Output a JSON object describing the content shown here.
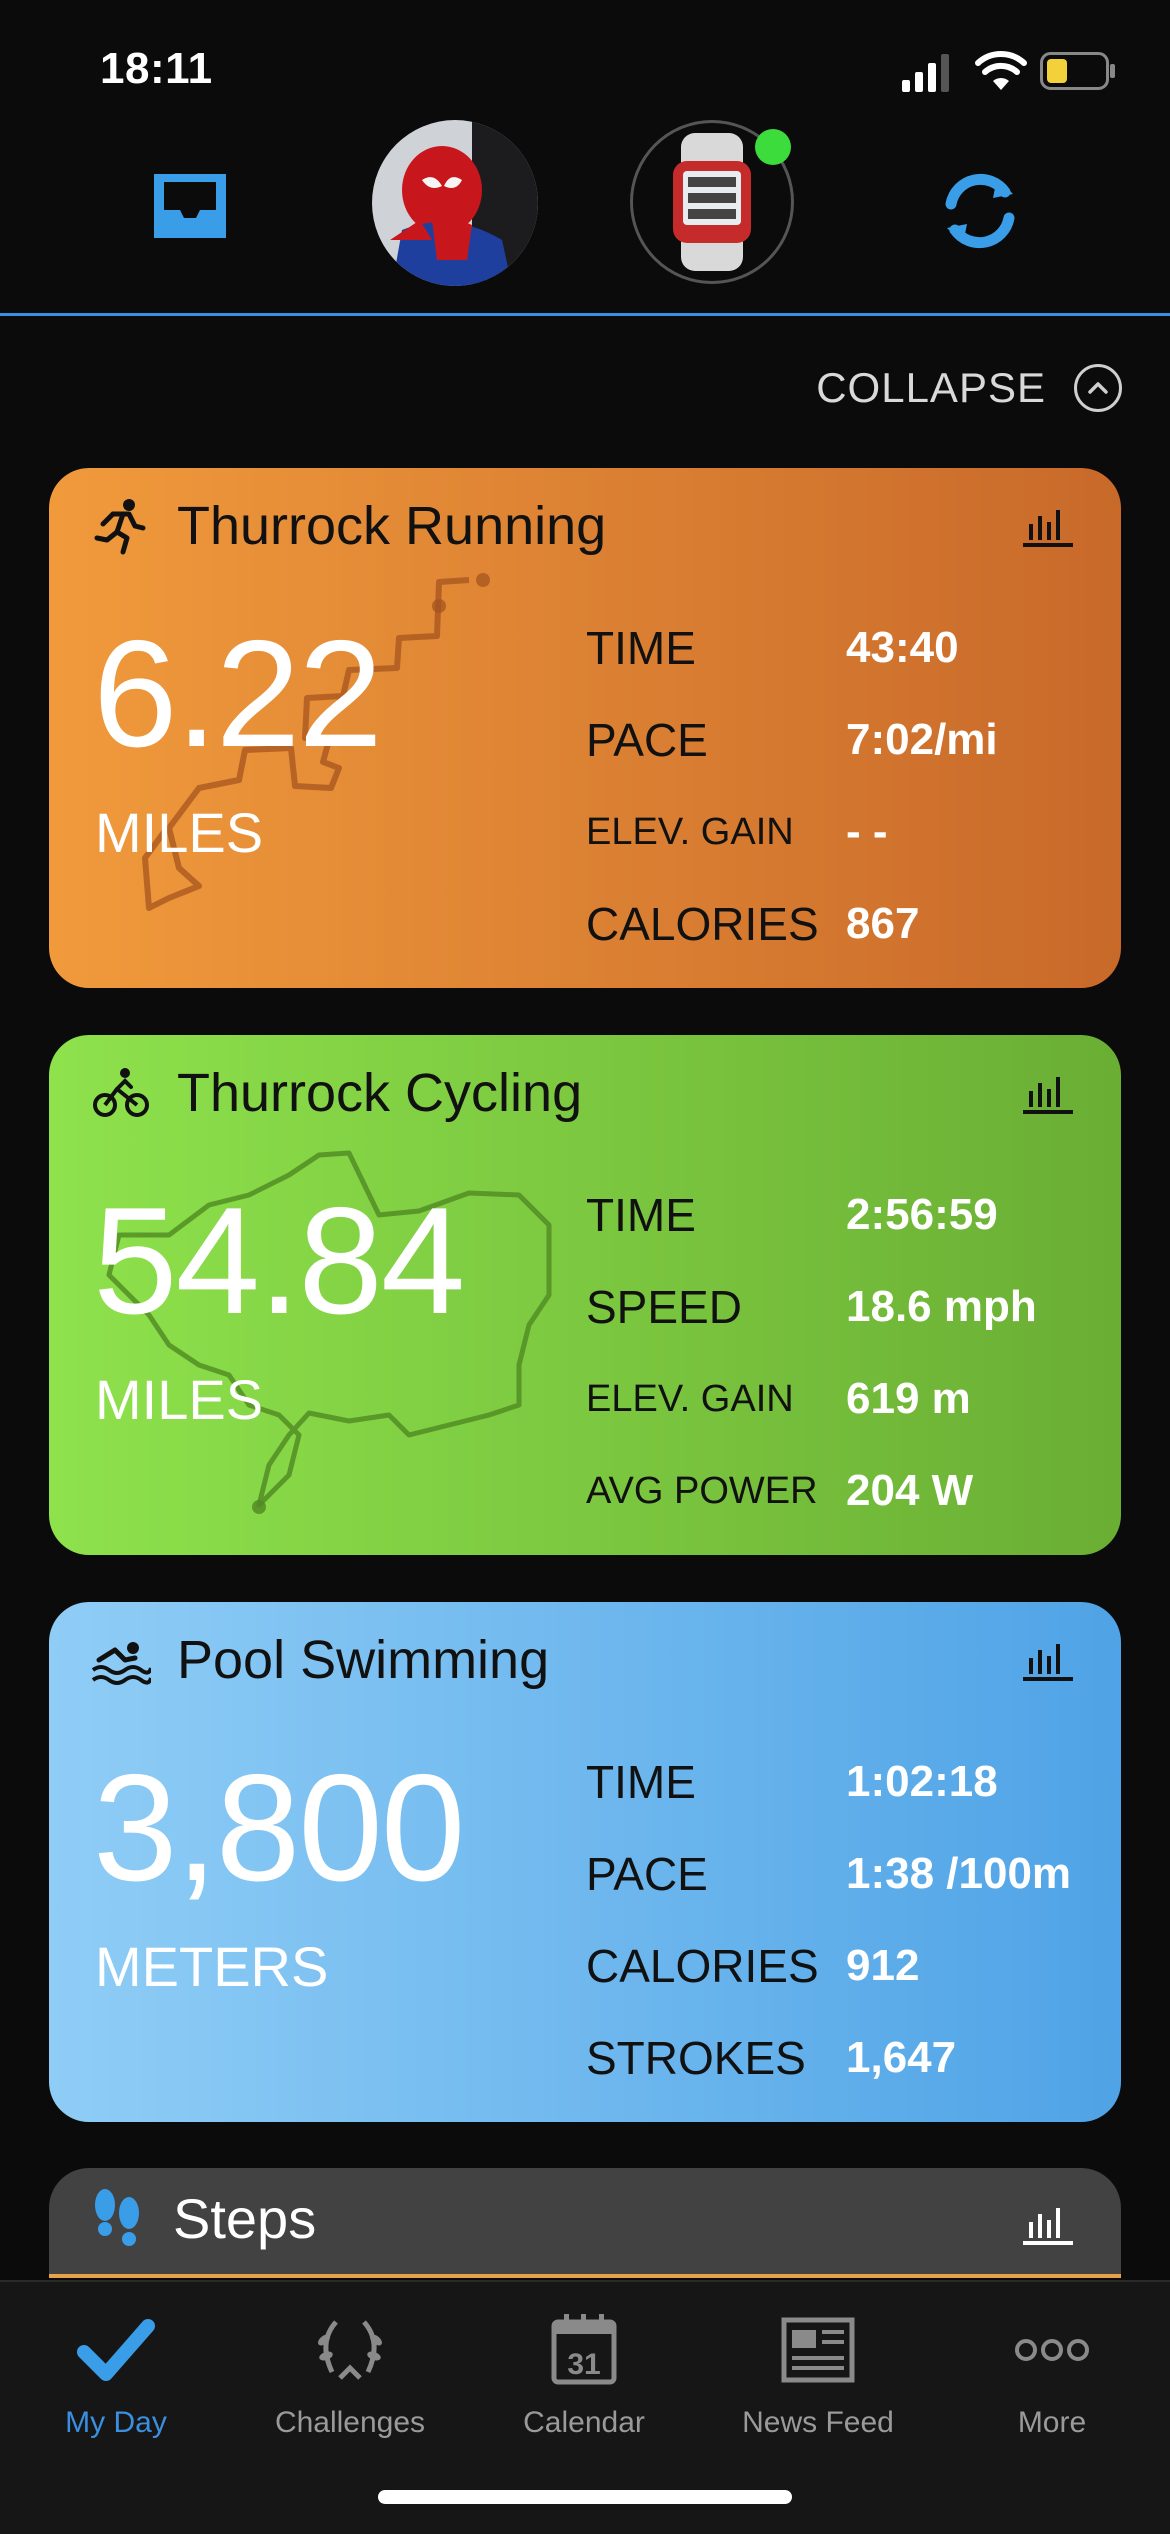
{
  "status_bar": {
    "time": "18:11"
  },
  "collapse_label": "COLLAPSE",
  "cards": [
    {
      "id": "running",
      "title": "Thurrock Running",
      "big_value": "6.22",
      "unit": "MILES",
      "stats": [
        {
          "label": "TIME",
          "value": "43:40"
        },
        {
          "label": "PACE",
          "value": "7:02/mi"
        },
        {
          "label": "ELEV. GAIN",
          "value": "- -"
        },
        {
          "label": "CALORIES",
          "value": "867"
        }
      ],
      "color": "#f09a3c"
    },
    {
      "id": "cycling",
      "title": "Thurrock Cycling",
      "big_value": "54.84",
      "unit": "MILES",
      "stats": [
        {
          "label": "TIME",
          "value": "2:56:59"
        },
        {
          "label": "SPEED",
          "value": "18.6 mph"
        },
        {
          "label": "ELEV. GAIN",
          "value": "619 m"
        },
        {
          "label": "AVG POWER",
          "value": "204 W"
        }
      ],
      "color": "#8ee24c"
    },
    {
      "id": "swimming",
      "title": "Pool Swimming",
      "big_value": "3,800",
      "unit": "METERS",
      "stats": [
        {
          "label": "TIME",
          "value": "1:02:18"
        },
        {
          "label": "PACE",
          "value": "1:38 /100m"
        },
        {
          "label": "CALORIES",
          "value": "912"
        },
        {
          "label": "STROKES",
          "value": "1,647"
        }
      ],
      "color": "#4fa3e6"
    }
  ],
  "steps_card": {
    "title": "Steps"
  },
  "tabs": [
    {
      "label": "My Day",
      "icon": "checkmark-icon",
      "active": true
    },
    {
      "label": "Challenges",
      "icon": "laurel-icon",
      "active": false
    },
    {
      "label": "Calendar",
      "icon": "calendar-icon",
      "active": false,
      "day": "31"
    },
    {
      "label": "News Feed",
      "icon": "newspaper-icon",
      "active": false
    },
    {
      "label": "More",
      "icon": "more-icon",
      "active": false
    }
  ],
  "colors": {
    "accent": "#3a8fe0",
    "device_status": "#3ddc3d"
  }
}
